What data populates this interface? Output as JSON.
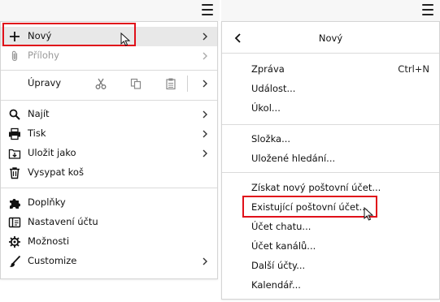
{
  "left_menu": {
    "items": [
      {
        "label": "Nový",
        "icon": "plus-icon"
      },
      {
        "label": "Přílohy",
        "icon": "paperclip-icon"
      },
      {
        "label": "Úpravy"
      },
      {
        "label": "Najít",
        "icon": "search-icon"
      },
      {
        "label": "Tisk",
        "icon": "printer-icon"
      },
      {
        "label": "Uložit jako",
        "icon": "save-as-icon"
      },
      {
        "label": "Vysypat koš",
        "icon": "trash-icon"
      },
      {
        "label": "Doplňky",
        "icon": "puzzle-icon"
      },
      {
        "label": "Nastavení účtu",
        "icon": "account-settings-icon"
      },
      {
        "label": "Možnosti",
        "icon": "gear-icon"
      },
      {
        "label": "Customize",
        "icon": "brush-icon"
      }
    ],
    "edit_tools": [
      "cut-icon",
      "copy-icon",
      "paste-icon"
    ]
  },
  "right_panel": {
    "title": "Nový",
    "items": [
      {
        "label": "Zpráva",
        "shortcut": "Ctrl+N"
      },
      {
        "label": "Událost..."
      },
      {
        "label": "Úkol..."
      },
      {
        "label": "Složka..."
      },
      {
        "label": "Uložené hledání..."
      },
      {
        "label": "Získat nový poštovní účet..."
      },
      {
        "label": "Existující poštovní účet..."
      },
      {
        "label": "Účet chatu..."
      },
      {
        "label": "Účet kanálů..."
      },
      {
        "label": "Další účty..."
      },
      {
        "label": "Kalendář..."
      }
    ]
  },
  "colors": {
    "highlight_box": "#e0101a",
    "hover_bg": "#e8e8e8",
    "separator": "#dadada"
  }
}
